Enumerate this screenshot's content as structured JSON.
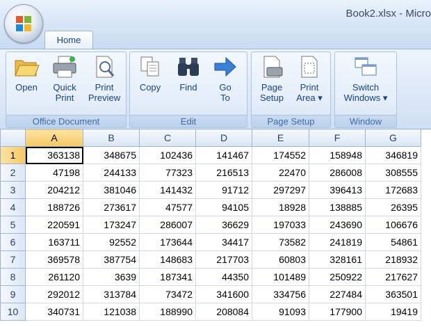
{
  "window": {
    "title": "Book2.xlsx - Micro"
  },
  "tabs": [
    {
      "label": "Home",
      "active": true
    }
  ],
  "ribbon": {
    "groups": [
      {
        "name": "Office Document",
        "buttons": [
          {
            "label1": "Open",
            "label2": "",
            "icon": "open-folder-icon"
          },
          {
            "label1": "Quick",
            "label2": "Print",
            "icon": "printer-icon"
          },
          {
            "label1": "Print",
            "label2": "Preview",
            "icon": "print-preview-icon"
          }
        ]
      },
      {
        "name": "Edit",
        "buttons": [
          {
            "label1": "Copy",
            "label2": "",
            "icon": "copy-icon"
          },
          {
            "label1": "Find",
            "label2": "",
            "icon": "binoculars-icon"
          },
          {
            "label1": "Go",
            "label2": "To",
            "icon": "arrow-right-icon"
          }
        ]
      },
      {
        "name": "Page Setup",
        "buttons": [
          {
            "label1": "Page",
            "label2": "Setup",
            "icon": "page-setup-icon"
          },
          {
            "label1": "Print",
            "label2": "Area ▾",
            "icon": "print-area-icon"
          }
        ]
      },
      {
        "name": "Window",
        "buttons": [
          {
            "label1": "Switch",
            "label2": "Windows ▾",
            "icon": "switch-windows-icon"
          }
        ]
      }
    ]
  },
  "sheet": {
    "columns": [
      "A",
      "B",
      "C",
      "D",
      "E",
      "F",
      "G"
    ],
    "selected_cell": "A1",
    "rows": [
      {
        "num": "1",
        "cells": [
          "363138",
          "348675",
          "102436",
          "141467",
          "174552",
          "158948",
          "346819"
        ]
      },
      {
        "num": "2",
        "cells": [
          "47198",
          "244133",
          "77323",
          "216513",
          "22470",
          "286008",
          "308555"
        ]
      },
      {
        "num": "3",
        "cells": [
          "204212",
          "381046",
          "141432",
          "91712",
          "297297",
          "396413",
          "172683"
        ]
      },
      {
        "num": "4",
        "cells": [
          "188726",
          "273617",
          "47577",
          "94105",
          "18928",
          "138885",
          "26395"
        ]
      },
      {
        "num": "5",
        "cells": [
          "220591",
          "173247",
          "286007",
          "36629",
          "197033",
          "243690",
          "106676"
        ]
      },
      {
        "num": "6",
        "cells": [
          "163711",
          "92552",
          "173644",
          "34417",
          "73582",
          "241819",
          "54861"
        ]
      },
      {
        "num": "7",
        "cells": [
          "369578",
          "387754",
          "148683",
          "217703",
          "60803",
          "328161",
          "218932"
        ]
      },
      {
        "num": "8",
        "cells": [
          "261120",
          "3639",
          "187341",
          "44350",
          "101489",
          "250922",
          "217627"
        ]
      },
      {
        "num": "9",
        "cells": [
          "292012",
          "313784",
          "73472",
          "341600",
          "334756",
          "227484",
          "363501"
        ]
      },
      {
        "num": "10",
        "cells": [
          "340731",
          "121038",
          "188990",
          "208084",
          "91093",
          "177900",
          "19419"
        ]
      }
    ]
  }
}
